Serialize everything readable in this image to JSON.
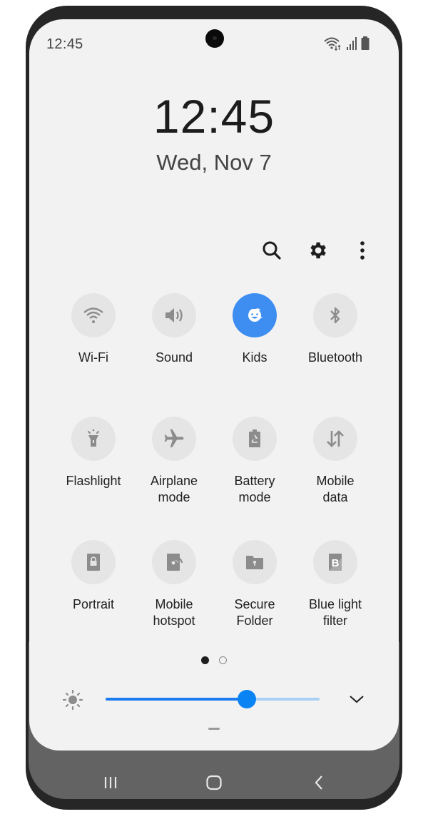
{
  "status_bar": {
    "time": "12:45",
    "icons": [
      "wifi-data-icon",
      "signal-icon",
      "battery-icon"
    ]
  },
  "lock_clock": {
    "time": "12:45",
    "date": "Wed, Nov 7"
  },
  "toolbar": {
    "icons": [
      "search-icon",
      "gear-icon",
      "more-vertical-icon"
    ]
  },
  "quick_settings": {
    "accent_color": "#3d8ef0",
    "tiles": [
      {
        "label": "Wi-Fi",
        "icon": "wifi-icon",
        "active": false
      },
      {
        "label": "Sound",
        "icon": "speaker-icon",
        "active": false
      },
      {
        "label": "Kids",
        "icon": "kids-face-icon",
        "active": true
      },
      {
        "label": "Bluetooth",
        "icon": "bluetooth-icon",
        "active": false
      },
      {
        "label": "Flashlight",
        "icon": "flashlight-icon",
        "active": false
      },
      {
        "label": "Airplane\nmode",
        "icon": "airplane-icon",
        "active": false
      },
      {
        "label": "Battery\nmode",
        "icon": "battery-recycle-icon",
        "active": false
      },
      {
        "label": "Mobile\ndata",
        "icon": "data-arrows-icon",
        "active": false
      },
      {
        "label": "Portrait",
        "icon": "portrait-lock-icon",
        "active": false
      },
      {
        "label": "Mobile\nhotspot",
        "icon": "hotspot-icon",
        "active": false
      },
      {
        "label": "Secure\nFolder",
        "icon": "secure-folder-icon",
        "active": false
      },
      {
        "label": "Blue light\nfilter",
        "icon": "blue-light-icon",
        "active": false
      }
    ],
    "page_indicator": {
      "current": 1,
      "total": 2
    }
  },
  "brightness": {
    "value_fraction": 0.66,
    "fill_color": "#1a7cf0",
    "track_color": "#a9cff5"
  },
  "nav_bar": {
    "buttons": [
      "recents-icon",
      "home-icon",
      "back-icon"
    ]
  }
}
